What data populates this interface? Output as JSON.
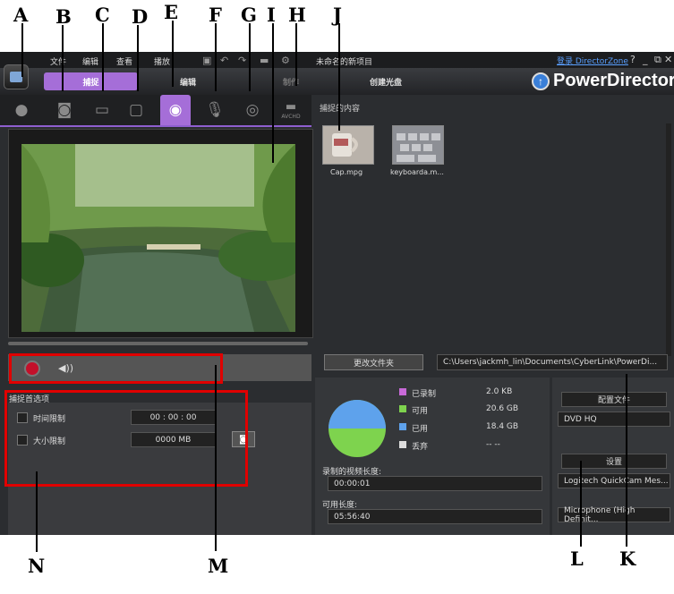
{
  "callouts": {
    "top": [
      "A",
      "B",
      "C",
      "D",
      "E",
      "F",
      "G",
      "I",
      "H",
      "J"
    ],
    "bottom": [
      "N",
      "M",
      "L",
      "K"
    ]
  },
  "menubar": {
    "items": [
      "文件",
      "编辑",
      "查看",
      "播放"
    ],
    "project_title": "未命名的新项目",
    "directorzone_link": "登录 DirectorZone",
    "help": "?",
    "minimize": "_",
    "restore": "⧉",
    "close": "✕"
  },
  "modes": {
    "capture": "捕捉",
    "edit": "编辑",
    "produce": "制作",
    "create_disc": "创建光盘"
  },
  "brand": "PowerDirector",
  "capture_sources": [
    {
      "name": "webcam",
      "active": false
    },
    {
      "name": "dv-camcorder",
      "active": false
    },
    {
      "name": "tv",
      "active": false
    },
    {
      "name": "digital-tv",
      "active": false
    },
    {
      "name": "webcam-active",
      "active": true
    },
    {
      "name": "microphone",
      "active": false
    },
    {
      "name": "optical-disc",
      "active": false
    },
    {
      "name": "avchd",
      "active": false
    }
  ],
  "avchd_label": "AVCHD",
  "captured_content": {
    "title": "捕捉的内容",
    "items": [
      {
        "label": "Cap.mpg",
        "icon": "mug-thumbnail"
      },
      {
        "label": "keyboarda.m...",
        "icon": "keyboard-thumbnail"
      }
    ]
  },
  "folder": {
    "change_button": "更改文件夹",
    "path": "C:\\Users\\jackmh_lin\\Documents\\CyberLink\\PowerDi..."
  },
  "disk": {
    "legend": [
      {
        "label": "已录制",
        "value": "2.0  KB",
        "color": "#c86ad8"
      },
      {
        "label": "可用",
        "value": "20.6  GB",
        "color": "#7ed34e"
      },
      {
        "label": "已用",
        "value": "18.4  GB",
        "color": "#5ea2ec"
      },
      {
        "label": "丢弃",
        "value": "-- --",
        "color": "#dddddd"
      }
    ],
    "recorded_length_label": "录制的视频长度:",
    "recorded_length": "00:00:01",
    "available_length_label": "可用长度:",
    "available_length": "05:56:40"
  },
  "profile": {
    "button": "配置文件",
    "value": "DVD HQ"
  },
  "settings": {
    "button": "设置",
    "video_device": "Logitech QuickCam Mes...",
    "audio_device": "Microphone (High Definit..."
  },
  "prefs": {
    "title": "捕捉首选项",
    "time_limit_label": "时间限制",
    "time_limit_value": "00 : 00 : 00",
    "size_limit_label": "大小限制",
    "size_limit_value": "0000    MB"
  },
  "colors": {
    "accent": "#a56ed8",
    "highlight": "#e00000",
    "pie_available": "#7ed34e",
    "pie_used": "#5ea2ec"
  }
}
